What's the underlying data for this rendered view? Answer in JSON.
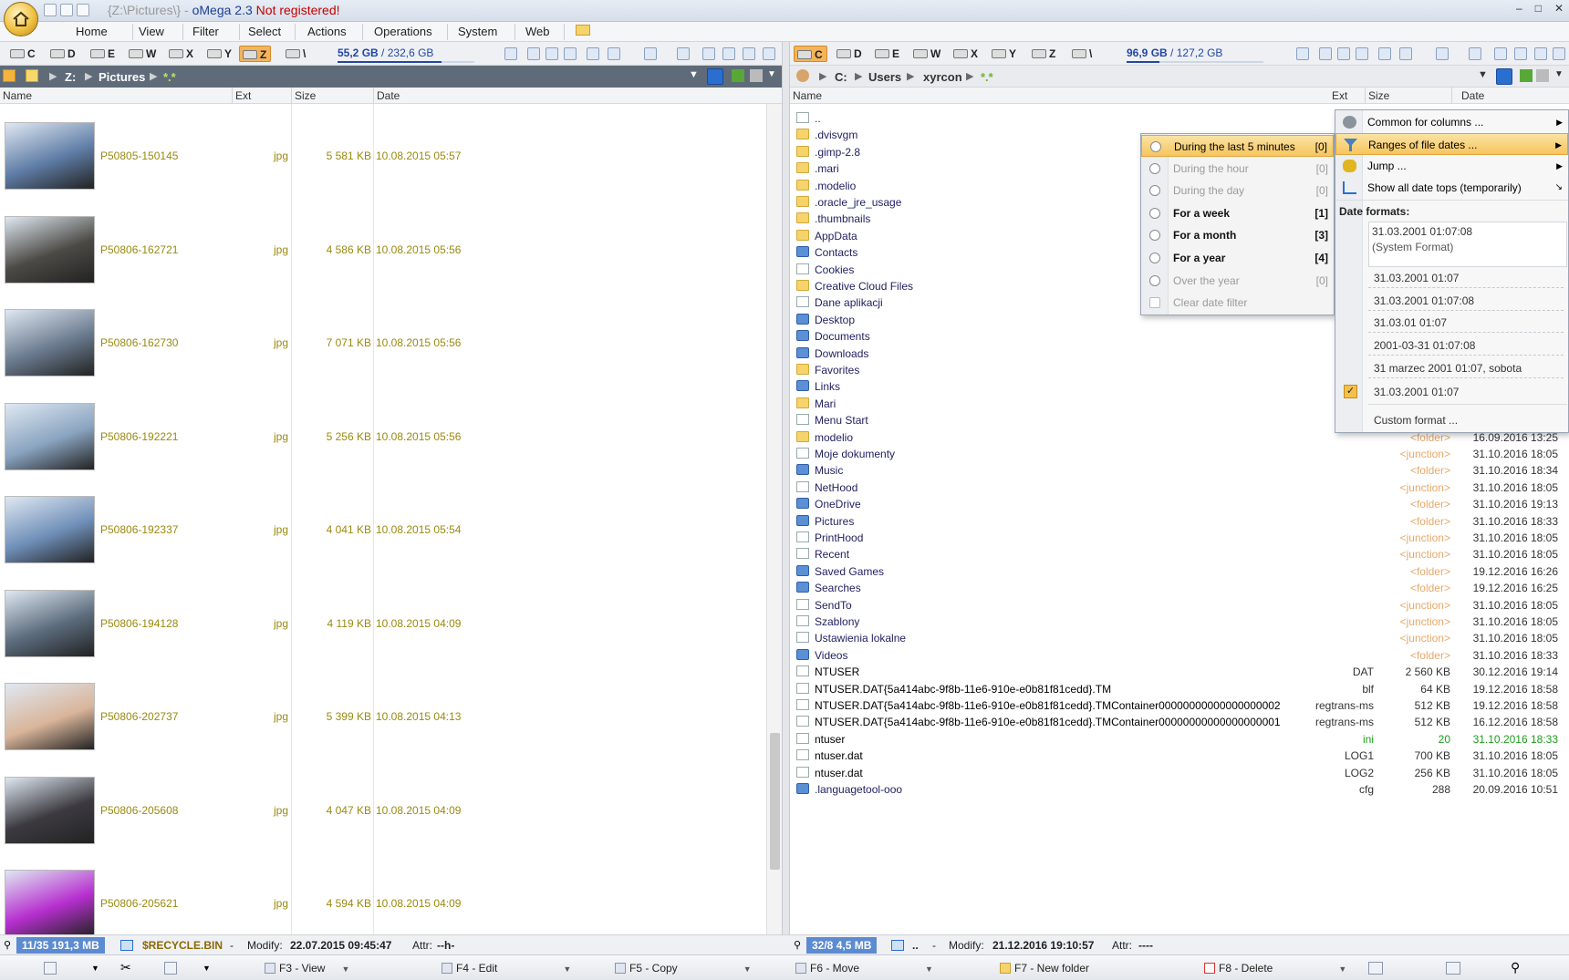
{
  "titlebar": {
    "path": "{Z:\\Pictures\\}",
    "dash": "-",
    "app": "oMega 2.3",
    "warning": "Not registered!",
    "minimize": "–",
    "maximize": "□",
    "close": "✕"
  },
  "menu": [
    "Home",
    "View",
    "Filter",
    "Select",
    "Actions",
    "Operations",
    "System",
    "Web"
  ],
  "left": {
    "drives": [
      "C",
      "D",
      "E",
      "W",
      "X",
      "Y",
      "Z"
    ],
    "active_drive": "Z",
    "space_free": "55,2 GB",
    "space_total": "232,6 GB",
    "space_sep": " / ",
    "path": [
      "Z:",
      "Pictures",
      "*.*"
    ],
    "columns": {
      "name": "Name",
      "ext": "Ext",
      "size": "Size",
      "date": "Date"
    },
    "files": [
      {
        "name": "P50805-150145",
        "ext": "jpg",
        "size": "5 581 KB",
        "date": "10.08.2015 05:57",
        "color": "#5f7da6"
      },
      {
        "name": "P50806-162721",
        "ext": "jpg",
        "size": "4 586 KB",
        "date": "10.08.2015 05:56",
        "color": "#4c4a45"
      },
      {
        "name": "P50806-162730",
        "ext": "jpg",
        "size": "7 071 KB",
        "date": "10.08.2015 05:56",
        "color": "#6a7a8e"
      },
      {
        "name": "P50806-192221",
        "ext": "jpg",
        "size": "5 256 KB",
        "date": "10.08.2015 05:56",
        "color": "#8aa4c0"
      },
      {
        "name": "P50806-192337",
        "ext": "jpg",
        "size": "4 041 KB",
        "date": "10.08.2015 05:54",
        "color": "#6f8fb8"
      },
      {
        "name": "P50806-194128",
        "ext": "jpg",
        "size": "4 119 KB",
        "date": "10.08.2015 04:09",
        "color": "#5b6b7c"
      },
      {
        "name": "P50806-202737",
        "ext": "jpg",
        "size": "5 399 KB",
        "date": "10.08.2015 04:13",
        "color": "#d9b59a"
      },
      {
        "name": "P50806-205608",
        "ext": "jpg",
        "size": "4 047 KB",
        "date": "10.08.2015 04:09",
        "color": "#3c3a40"
      },
      {
        "name": "P50806-205621",
        "ext": "jpg",
        "size": "4 594 KB",
        "date": "10.08.2015 04:09",
        "color": "#b62fcf"
      }
    ]
  },
  "right": {
    "drives": [
      "C",
      "D",
      "E",
      "W",
      "X",
      "Y",
      "Z"
    ],
    "active_drive": "C",
    "space_free": "96,9 GB",
    "space_total": "127,2 GB",
    "space_sep": " / ",
    "path": [
      "C:",
      "Users",
      "xyrcon",
      "*.*"
    ],
    "columns": {
      "name": "Name",
      "ext": "Ext",
      "size": "Size",
      "date": "Date"
    },
    "files": [
      {
        "name": "..",
        "icon": "up",
        "ext": "",
        "size": "",
        "date": ""
      },
      {
        "name": ".dvisvgm",
        "icon": "folder",
        "ext": "",
        "size": "",
        "date": ""
      },
      {
        "name": ".gimp-2.8",
        "icon": "folder",
        "ext": "",
        "size": "",
        "date": ""
      },
      {
        "name": ".mari",
        "icon": "folder",
        "ext": "",
        "size": "",
        "date": ""
      },
      {
        "name": ".modelio",
        "icon": "folder",
        "ext": "",
        "size": "",
        "date": ""
      },
      {
        "name": ".oracle_jre_usage",
        "icon": "folder",
        "ext": "",
        "size": "",
        "date": ""
      },
      {
        "name": ".thumbnails",
        "icon": "folder",
        "ext": "",
        "size": "",
        "date": ""
      },
      {
        "name": "AppData",
        "icon": "folder",
        "ext": "",
        "size": "",
        "date": ""
      },
      {
        "name": "Contacts",
        "icon": "sys",
        "ext": "",
        "size": "",
        "date": ""
      },
      {
        "name": "Cookies",
        "icon": "file",
        "ext": "",
        "size": "",
        "date": ""
      },
      {
        "name": "Creative Cloud Files",
        "icon": "cc",
        "ext": "",
        "size": "",
        "date": ""
      },
      {
        "name": "Dane aplikacji",
        "icon": "file",
        "ext": "",
        "size": "",
        "date": ""
      },
      {
        "name": "Desktop",
        "icon": "sys",
        "ext": "",
        "size": "",
        "date": ""
      },
      {
        "name": "Documents",
        "icon": "sys",
        "ext": "",
        "size": "",
        "date": ""
      },
      {
        "name": "Downloads",
        "icon": "sys",
        "ext": "",
        "size": "",
        "date": ""
      },
      {
        "name": "Favorites",
        "icon": "star",
        "ext": "",
        "size": "",
        "date": ""
      },
      {
        "name": "Links",
        "icon": "sys",
        "ext": "",
        "size": "",
        "date": ""
      },
      {
        "name": "Mari",
        "icon": "folder",
        "ext": "",
        "size": "",
        "date": ""
      },
      {
        "name": "Menu Start",
        "icon": "file",
        "ext": "",
        "size": "",
        "date": ""
      },
      {
        "name": "modelio",
        "icon": "folder",
        "ext": "",
        "size": "<folder>",
        "date": "16.09.2016 13:25"
      },
      {
        "name": "Moje dokumenty",
        "icon": "file",
        "ext": "",
        "size": "<junction>",
        "date": "31.10.2016 18:05"
      },
      {
        "name": "Music",
        "icon": "sys",
        "ext": "",
        "size": "<folder>",
        "date": "31.10.2016 18:34"
      },
      {
        "name": "NetHood",
        "icon": "file",
        "ext": "",
        "size": "<junction>",
        "date": "31.10.2016 18:05"
      },
      {
        "name": "OneDrive",
        "icon": "sys",
        "ext": "",
        "size": "<folder>",
        "date": "31.10.2016 19:13"
      },
      {
        "name": "Pictures",
        "icon": "sys",
        "ext": "",
        "size": "<folder>",
        "date": "31.10.2016 18:33"
      },
      {
        "name": "PrintHood",
        "icon": "file",
        "ext": "",
        "size": "<junction>",
        "date": "31.10.2016 18:05"
      },
      {
        "name": "Recent",
        "icon": "file",
        "ext": "",
        "size": "<junction>",
        "date": "31.10.2016 18:05"
      },
      {
        "name": "Saved Games",
        "icon": "sys",
        "ext": "",
        "size": "<folder>",
        "date": "19.12.2016 16:26"
      },
      {
        "name": "Searches",
        "icon": "sys",
        "ext": "",
        "size": "<folder>",
        "date": "19.12.2016 16:25"
      },
      {
        "name": "SendTo",
        "icon": "file",
        "ext": "",
        "size": "<junction>",
        "date": "31.10.2016 18:05"
      },
      {
        "name": "Szablony",
        "icon": "file",
        "ext": "",
        "size": "<junction>",
        "date": "31.10.2016 18:05"
      },
      {
        "name": "Ustawienia lokalne",
        "icon": "file",
        "ext": "",
        "size": "<junction>",
        "date": "31.10.2016 18:05"
      },
      {
        "name": "Videos",
        "icon": "sys",
        "ext": "",
        "size": "<folder>",
        "date": "31.10.2016 18:33"
      },
      {
        "name": "NTUSER",
        "icon": "file",
        "ext": "DAT",
        "size": "2 560 KB",
        "date": "30.12.2016 19:14"
      },
      {
        "name": "NTUSER.DAT{5a414abc-9f8b-11e6-910e-e0b81f81cedd}.TM",
        "icon": "file",
        "ext": "blf",
        "size": "64 KB",
        "date": "19.12.2016 18:58"
      },
      {
        "name": "NTUSER.DAT{5a414abc-9f8b-11e6-910e-e0b81f81cedd}.TMContainer00000000000000000002",
        "icon": "file",
        "ext": "regtrans-ms",
        "size": "512 KB",
        "date": "19.12.2016 18:58"
      },
      {
        "name": "NTUSER.DAT{5a414abc-9f8b-11e6-910e-e0b81f81cedd}.TMContainer00000000000000000001",
        "icon": "file",
        "ext": "regtrans-ms",
        "size": "512 KB",
        "date": "16.12.2016 18:58"
      },
      {
        "name": "ntuser",
        "icon": "file",
        "ext": "ini",
        "size": "20",
        "date": "31.10.2016 18:33",
        "green": true
      },
      {
        "name": "ntuser.dat",
        "icon": "file",
        "ext": "LOG1",
        "size": "700 KB",
        "date": "31.10.2016 18:05"
      },
      {
        "name": "ntuser.dat",
        "icon": "file",
        "ext": "LOG2",
        "size": "256 KB",
        "date": "31.10.2016 18:05"
      },
      {
        "name": ".languagetool-ooo",
        "icon": "sys",
        "ext": "cfg",
        "size": "288",
        "date": "20.09.2016 10:51"
      }
    ]
  },
  "menu_main": {
    "items": [
      {
        "label": "Common for columns ...",
        "icon": "gear-icon"
      },
      {
        "label": "Ranges of file dates ...",
        "icon": "filter-icon",
        "highlight": true
      },
      {
        "label": "Jump ...",
        "icon": "jump-icon"
      },
      {
        "label": "Show all date tops (temporarily)",
        "icon": "chart-icon"
      }
    ],
    "formats_header": "Date formats:",
    "formats": [
      "31.03.2001 01:07:08",
      "(System Format)",
      "31.03.2001 01:07",
      "31.03.2001 01:07:08",
      "31.03.01 01:07",
      "2001-03-31 01:07:08",
      "31 marzec 2001 01:07, sobota",
      "31.03.2001 01:07"
    ],
    "custom": "Custom format ...",
    "check": "✓"
  },
  "menu_sub": {
    "items": [
      {
        "label": "During the last 5 minutes",
        "count": "[0]",
        "state": "hl"
      },
      {
        "label": "During the hour",
        "count": "[0]",
        "state": "disabled"
      },
      {
        "label": "During the day",
        "count": "[0]",
        "state": "disabled"
      },
      {
        "label": "For a week",
        "count": "[1]",
        "state": "bold"
      },
      {
        "label": "For a month",
        "count": "[3]",
        "state": "bold"
      },
      {
        "label": "For a year",
        "count": "[4]",
        "state": "bold"
      },
      {
        "label": "Over the year",
        "count": "[0]",
        "state": "disabled"
      },
      {
        "label": "Clear date filter",
        "count": "",
        "state": "disabled"
      }
    ]
  },
  "status_left": {
    "count": "11/35",
    "size": "191,3 MB",
    "name": "$RECYCLE.BIN",
    "dash": "-",
    "modify_label": "Modify:",
    "modify": "22.07.2015 09:45:47",
    "attr_label": "Attr:",
    "attr": "--h-"
  },
  "status_right": {
    "count": "32/8",
    "size": "4,5 MB",
    "name": "..",
    "dash": "-",
    "modify_label": "Modify:",
    "modify": "21.12.2016 19:10:57",
    "attr_label": "Attr:",
    "attr": "----"
  },
  "fkeys": [
    "F3 - View",
    "F4 - Edit",
    "F5 - Copy",
    "F6 - Move",
    "F7 - New folder",
    "F8 - Delete"
  ]
}
